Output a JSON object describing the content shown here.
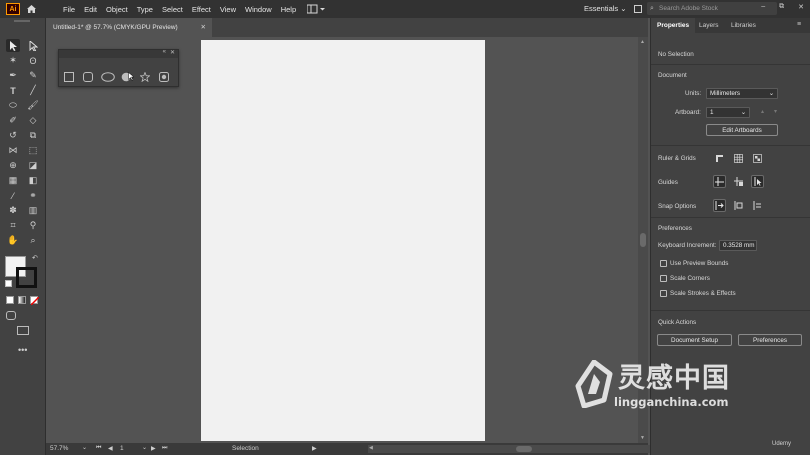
{
  "app": {
    "logo_text": "Ai"
  },
  "menu": [
    "File",
    "Edit",
    "Object",
    "Type",
    "Select",
    "Effect",
    "View",
    "Window",
    "Help"
  ],
  "workspace": {
    "label": "Essentials"
  },
  "search": {
    "placeholder": "Search Adobe Stock"
  },
  "window_controls": [
    "–",
    "⧉",
    "✕"
  ],
  "document_tab": {
    "title": "Untitled-1* @ 57.7% (CMYK/GPU Preview)",
    "close": "✕"
  },
  "shapes_panel": {
    "collapse_glyph": "«",
    "close_glyph": "✕",
    "shapes": [
      "rectangle",
      "rounded-rectangle",
      "ellipse",
      "polygon",
      "star",
      "flare"
    ]
  },
  "status": {
    "zoom": "57.7%",
    "artboard": "1",
    "tool": "Selection"
  },
  "panel": {
    "tabs": [
      "Properties",
      "Layers",
      "Libraries"
    ],
    "no_selection": "No Selection",
    "document_header": "Document",
    "units_label": "Units:",
    "units_value": "Millimeters",
    "artboard_label": "Artboard:",
    "artboard_value": "1",
    "edit_artboards": "Edit Artboards",
    "rulers_grids": "Ruler & Grids",
    "guides": "Guides",
    "snap_options": "Snap Options",
    "preferences_header": "Preferences",
    "keyboard_increment_label": "Keyboard Increment:",
    "keyboard_increment_value": "0.3528 mm",
    "checkboxes": [
      "Use Preview Bounds",
      "Scale Corners",
      "Scale Strokes & Effects"
    ],
    "quick_actions": "Quick Actions",
    "document_setup": "Document Setup",
    "preferences_button": "Preferences"
  },
  "watermark": {
    "chinese": "灵感中国",
    "url": "lingganchina.com"
  },
  "udemy": "Udemy"
}
